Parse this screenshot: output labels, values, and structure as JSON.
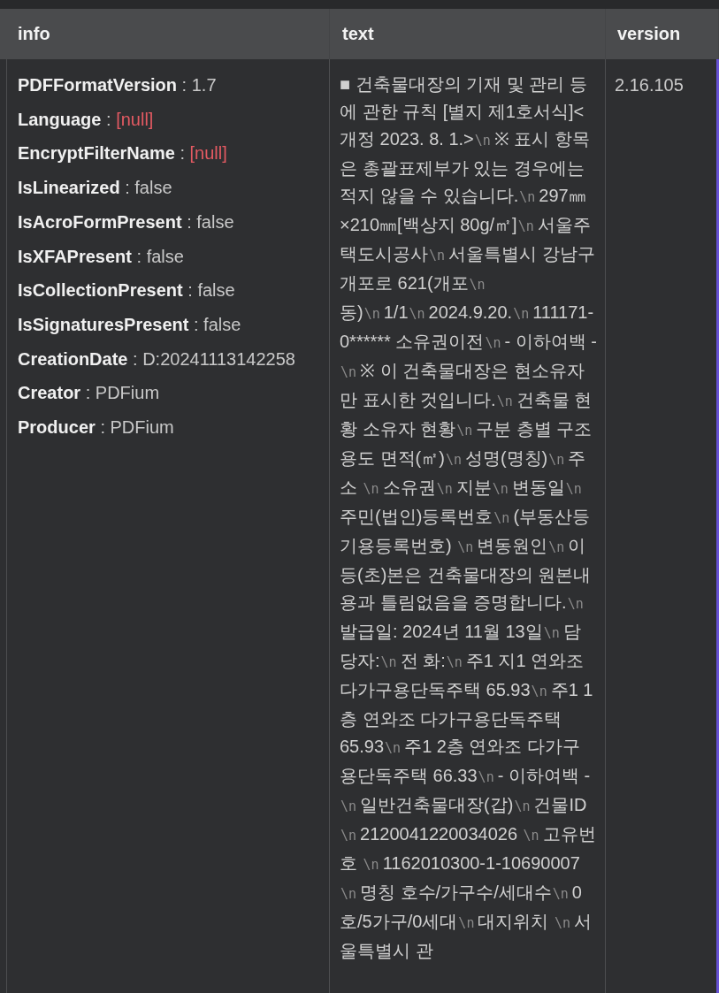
{
  "table": {
    "columns": [
      "info",
      "text",
      "version"
    ],
    "rows": [
      {
        "info": [
          {
            "key": "PDFFormatVersion",
            "separator": ":",
            "value": "1.7",
            "kind": "value"
          },
          {
            "key": "Language",
            "separator": ":",
            "value": "[null]",
            "kind": "null"
          },
          {
            "key": "EncryptFilterName",
            "separator": ":",
            "value": "[null]",
            "kind": "null"
          },
          {
            "key": "IsLinearized",
            "separator": ":",
            "value": "false",
            "kind": "value"
          },
          {
            "key": "IsAcroFormPresent",
            "separator": ":",
            "value": "false",
            "kind": "value"
          },
          {
            "key": "IsXFAPresent",
            "separator": ":",
            "value": "false",
            "kind": "value"
          },
          {
            "key": "IsCollectionPresent",
            "separator": ":",
            "value": "false",
            "kind": "value"
          },
          {
            "key": "IsSignaturesPresent",
            "separator": ":",
            "value": "false",
            "kind": "value"
          },
          {
            "key": "CreationDate",
            "separator": ":",
            "value": "D:20241113142258",
            "kind": "value"
          },
          {
            "key": "Creator",
            "separator": ":",
            "value": "PDFium",
            "kind": "value"
          },
          {
            "key": "Producer",
            "separator": ":",
            "value": "PDFium",
            "kind": "value"
          }
        ],
        "text": [
          {
            "kind": "plain",
            "text": "■ 건축물대장의 기재 및 관리 등에 관한 규칙 [별지 제1호서식]<개정 2023. 8. 1.>"
          },
          {
            "kind": "escape",
            "text": "\\n"
          },
          {
            "kind": "plain",
            "text": "※ 표시 항목은 총괄표제부가 있는 경우에는 적지 않을 수 있습니다."
          },
          {
            "kind": "escape",
            "text": "\\n"
          },
          {
            "kind": "plain",
            "text": "297㎜×210㎜[백상지 80g/㎡]"
          },
          {
            "kind": "escape",
            "text": "\\n"
          },
          {
            "kind": "plain",
            "text": "서울주택도시공사"
          },
          {
            "kind": "escape",
            "text": "\\n"
          },
          {
            "kind": "plain",
            "text": "서울특별시 강남구 개포로 621(개포"
          },
          {
            "kind": "escape",
            "text": "\\n"
          },
          {
            "kind": "plain",
            "text": "동)"
          },
          {
            "kind": "escape",
            "text": "\\n"
          },
          {
            "kind": "plain",
            "text": "1/1"
          },
          {
            "kind": "escape",
            "text": "\\n"
          },
          {
            "kind": "plain",
            "text": "2024.9.20."
          },
          {
            "kind": "escape",
            "text": "\\n"
          },
          {
            "kind": "plain",
            "text": "111171-0****** 소유권이전"
          },
          {
            "kind": "escape",
            "text": "\\n"
          },
          {
            "kind": "plain",
            "text": "- 이하여백 -"
          },
          {
            "kind": "escape",
            "text": "\\n"
          },
          {
            "kind": "plain",
            "text": "※ 이 건축물대장은 현소유자만 표시한 것입니다."
          },
          {
            "kind": "escape",
            "text": "\\n"
          },
          {
            "kind": "plain",
            "text": "건축물 현황 소유자 현황"
          },
          {
            "kind": "escape",
            "text": "\\n"
          },
          {
            "kind": "plain",
            "text": "구분 층별 구조 용도 면적(㎡)"
          },
          {
            "kind": "escape",
            "text": "\\n"
          },
          {
            "kind": "plain",
            "text": "성명(명칭)"
          },
          {
            "kind": "escape",
            "text": "\\n"
          },
          {
            "kind": "plain",
            "text": "주소 "
          },
          {
            "kind": "escape",
            "text": "\\n"
          },
          {
            "kind": "plain",
            "text": "소유권"
          },
          {
            "kind": "escape",
            "text": "\\n"
          },
          {
            "kind": "plain",
            "text": "지분"
          },
          {
            "kind": "escape",
            "text": "\\n"
          },
          {
            "kind": "plain",
            "text": "변동일"
          },
          {
            "kind": "escape",
            "text": "\\n"
          },
          {
            "kind": "plain",
            "text": "주민(법인)등록번호"
          },
          {
            "kind": "escape",
            "text": "\\n"
          },
          {
            "kind": "plain",
            "text": "(부동산등기용등록번호) "
          },
          {
            "kind": "escape",
            "text": "\\n"
          },
          {
            "kind": "plain",
            "text": "변동원인"
          },
          {
            "kind": "escape",
            "text": "\\n"
          },
          {
            "kind": "plain",
            "text": "이 등(초)본은 건축물대장의 원본내용과 틀림없음을 증명합니다."
          },
          {
            "kind": "escape",
            "text": "\\n"
          },
          {
            "kind": "plain",
            "text": "발급일: 2024년 11월 13일"
          },
          {
            "kind": "escape",
            "text": "\\n"
          },
          {
            "kind": "plain",
            "text": "담당자:"
          },
          {
            "kind": "escape",
            "text": "\\n"
          },
          {
            "kind": "plain",
            "text": "전 화:"
          },
          {
            "kind": "escape",
            "text": "\\n"
          },
          {
            "kind": "plain",
            "text": "주1 지1 연와조 다가구용단독주택 65.93"
          },
          {
            "kind": "escape",
            "text": "\\n"
          },
          {
            "kind": "plain",
            "text": "주1 1층 연와조 다가구용단독주택 65.93"
          },
          {
            "kind": "escape",
            "text": "\\n"
          },
          {
            "kind": "plain",
            "text": "주1 2층 연와조 다가구용단독주택 66.33"
          },
          {
            "kind": "escape",
            "text": "\\n"
          },
          {
            "kind": "plain",
            "text": "- 이하여백 -"
          },
          {
            "kind": "escape",
            "text": "\\n"
          },
          {
            "kind": "plain",
            "text": "일반건축물대장(갑)"
          },
          {
            "kind": "escape",
            "text": "\\n"
          },
          {
            "kind": "plain",
            "text": "건물ID "
          },
          {
            "kind": "escape",
            "text": "\\n"
          },
          {
            "kind": "plain",
            "text": "2120041220034026 "
          },
          {
            "kind": "escape",
            "text": "\\n"
          },
          {
            "kind": "plain",
            "text": "고유번호 "
          },
          {
            "kind": "escape",
            "text": "\\n"
          },
          {
            "kind": "plain",
            "text": "1162010300-1-10690007 "
          },
          {
            "kind": "escape",
            "text": "\\n"
          },
          {
            "kind": "plain",
            "text": "명칭 호수/가구수/세대수"
          },
          {
            "kind": "escape",
            "text": "\\n"
          },
          {
            "kind": "plain",
            "text": "0호/5가구/0세대"
          },
          {
            "kind": "escape",
            "text": "\\n"
          },
          {
            "kind": "plain",
            "text": "대지위치 "
          },
          {
            "kind": "escape",
            "text": "\\n"
          },
          {
            "kind": "plain",
            "text": "서울특별시 관"
          }
        ],
        "version": "2.16.105"
      }
    ]
  }
}
